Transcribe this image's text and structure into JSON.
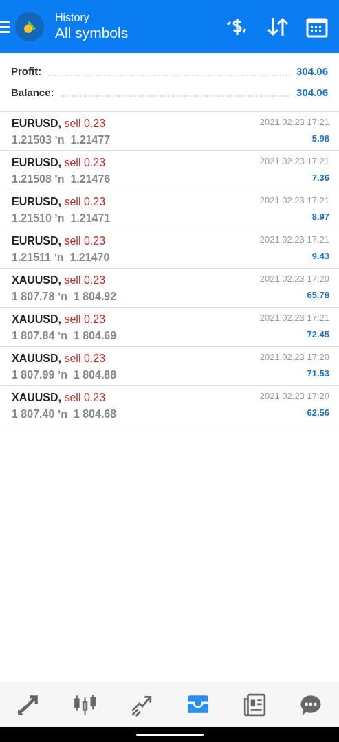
{
  "header": {
    "title": "History",
    "subtitle": "All symbols"
  },
  "summary": [
    {
      "label": "Profit:",
      "value": "304.06"
    },
    {
      "label": "Balance:",
      "value": "304.06"
    }
  ],
  "deals": [
    {
      "symbol": "EURUSD,",
      "action": "sell 0.23",
      "prices": "1.21503 ʼn  1.21477",
      "time": "2021.02.23 17:21",
      "profit": "5.98"
    },
    {
      "symbol": "EURUSD,",
      "action": "sell 0.23",
      "prices": "1.21508 ʼn  1.21476",
      "time": "2021.02.23 17:21",
      "profit": "7.36"
    },
    {
      "symbol": "EURUSD,",
      "action": "sell 0.23",
      "prices": "1.21510 ʼn  1.21471",
      "time": "2021.02.23 17:21",
      "profit": "8.97"
    },
    {
      "symbol": "EURUSD,",
      "action": "sell 0.23",
      "prices": "1.21511 ʼn  1.21470",
      "time": "2021.02.23 17:21",
      "profit": "9.43"
    },
    {
      "symbol": "XAUUSD,",
      "action": "sell 0.23",
      "prices": "1 807.78 ʼn  1 804.92",
      "time": "2021.02.23 17:20",
      "profit": "65.78"
    },
    {
      "symbol": "XAUUSD,",
      "action": "sell 0.23",
      "prices": "1 807.84 ʼn  1 804.69",
      "time": "2021.02.23 17:21",
      "profit": "72.45"
    },
    {
      "symbol": "XAUUSD,",
      "action": "sell 0.23",
      "prices": "1 807.99 ʼn  1 804.88",
      "time": "2021.02.23 17:20",
      "profit": "71.53"
    },
    {
      "symbol": "XAUUSD,",
      "action": "sell 0.23",
      "prices": "1 807.40 ʼn  1 804.68",
      "time": "2021.02.23 17:20",
      "profit": "62.56"
    }
  ],
  "bottom_nav": [
    {
      "kind": "quotes",
      "selected": false
    },
    {
      "kind": "chart",
      "selected": false
    },
    {
      "kind": "trade",
      "selected": false
    },
    {
      "kind": "history",
      "selected": true
    },
    {
      "kind": "news",
      "selected": false
    },
    {
      "kind": "chat",
      "selected": false
    }
  ]
}
